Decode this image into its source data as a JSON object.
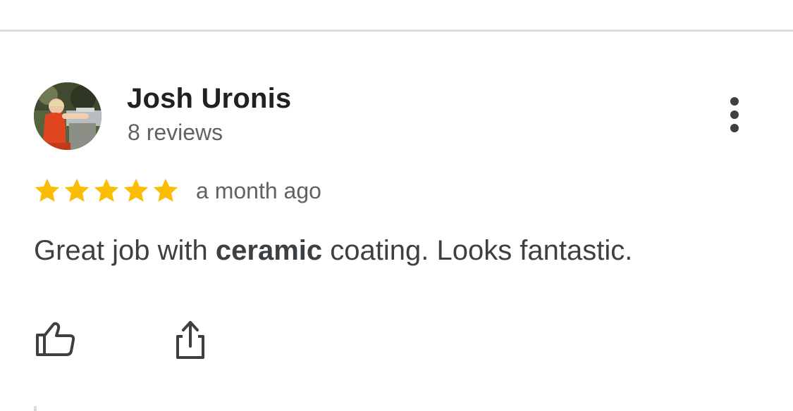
{
  "review": {
    "author": {
      "name": "Josh Uronis",
      "meta": "8 reviews",
      "avatar_icon": "user-avatar-photo"
    },
    "rating": 5,
    "rating_max": 5,
    "date": "a month ago",
    "text": {
      "before": "Great job with ",
      "highlight": "ceramic",
      "after": " coating. Looks fantastic."
    }
  },
  "actions": {
    "like_icon": "thumbs-up-icon",
    "share_icon": "share-icon",
    "more_icon": "more-vert-icon"
  },
  "colors": {
    "star": "#fbbc04",
    "name": "#202124",
    "secondary": "#5f6368",
    "body": "#3c4043",
    "icon": "#3c4043",
    "divider": "#dadce0"
  }
}
